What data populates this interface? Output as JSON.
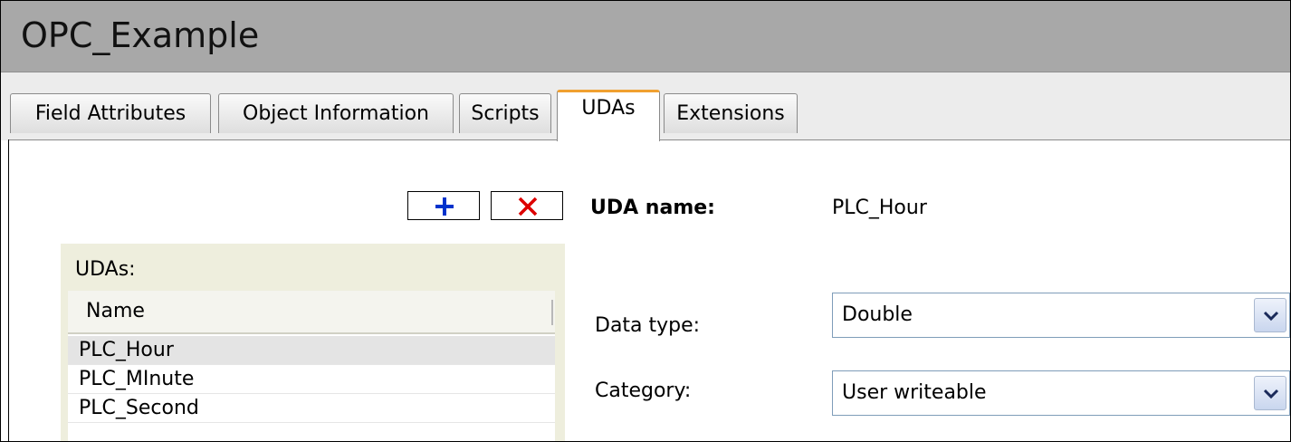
{
  "window": {
    "title": "OPC_Example"
  },
  "tabs": [
    {
      "label": "Field Attributes"
    },
    {
      "label": "Object Information"
    },
    {
      "label": "Scripts"
    },
    {
      "label": "UDAs"
    },
    {
      "label": "Extensions"
    }
  ],
  "active_tab": "UDAs",
  "toolbar": {
    "add_icon": "plus-icon",
    "delete_icon": "x-icon"
  },
  "uda_list": {
    "label": "UDAs:",
    "column_header": "Name",
    "rows": [
      "PLC_Hour",
      "PLC_MInute",
      "PLC_Second"
    ],
    "selected": "PLC_Hour"
  },
  "details": {
    "uda_name_label": "UDA name:",
    "uda_name_value": "PLC_Hour",
    "data_type_label": "Data type:",
    "data_type_value": "Double",
    "category_label": "Category:",
    "category_value": "User writeable"
  },
  "colors": {
    "add_icon": "#0033cc",
    "delete_icon": "#dd0000",
    "active_tab_accent": "#f0a030"
  }
}
